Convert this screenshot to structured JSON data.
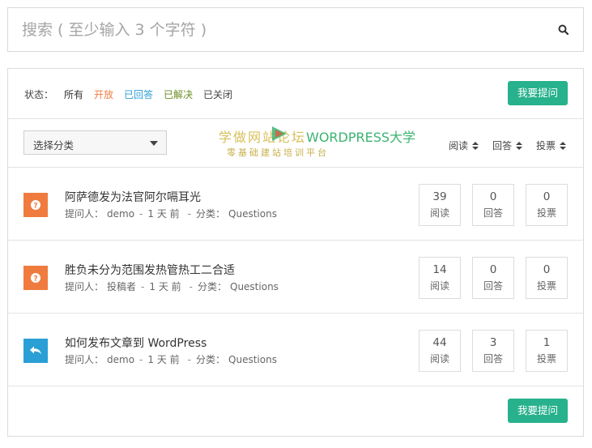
{
  "search": {
    "placeholder": "搜索 ( 至少输入 3 个字符 )",
    "icon": "search-icon"
  },
  "status_bar": {
    "label": "状态：",
    "filters": [
      {
        "label": "所有",
        "color": "#333333"
      },
      {
        "label": "开放",
        "color": "#f07b3f"
      },
      {
        "label": "已回答",
        "color": "#2a9fd6"
      },
      {
        "label": "已解决",
        "color": "#6b8e23"
      },
      {
        "label": "已关闭",
        "color": "#444444"
      }
    ],
    "ask_button": "我要提问"
  },
  "filter_row": {
    "category_select": "选择分类",
    "sort": [
      {
        "label": "阅读"
      },
      {
        "label": "回答"
      },
      {
        "label": "投票"
      }
    ]
  },
  "questions": [
    {
      "status_icon": "question-icon",
      "icon_color": "#f07b3f",
      "title": "阿萨德发为法官阿尔嗝耳光",
      "asker_label": "提问人：",
      "asker": "demo",
      "time": "1 天 前",
      "category_label": "分类：",
      "category": "Questions",
      "views": "39",
      "views_label": "阅读",
      "answers": "0",
      "answers_label": "回答",
      "votes": "0",
      "votes_label": "投票"
    },
    {
      "status_icon": "question-icon",
      "icon_color": "#f07b3f",
      "title": "胜负未分为范围发热管热工二合适",
      "asker_label": "提问人：",
      "asker": "投稿者",
      "time": "1 天 前",
      "category_label": "分类：",
      "category": "Questions",
      "views": "14",
      "views_label": "阅读",
      "answers": "0",
      "answers_label": "回答",
      "votes": "0",
      "votes_label": "投票"
    },
    {
      "status_icon": "reply-icon",
      "icon_color": "#2a9fd6",
      "title": "如何发布文章到 WordPress",
      "asker_label": "提问人：",
      "asker": "demo",
      "time": "1 天 前",
      "category_label": "分类：",
      "category": "Questions",
      "views": "44",
      "views_label": "阅读",
      "answers": "3",
      "answers_label": "回答",
      "votes": "1",
      "votes_label": "投票"
    }
  ],
  "footer": {
    "ask_button": "我要提问"
  },
  "watermark": {
    "line1_a": "学做网站论坛",
    "line1_b": "WORDPRESS大学",
    "line2": "零基础建站培训平台"
  }
}
